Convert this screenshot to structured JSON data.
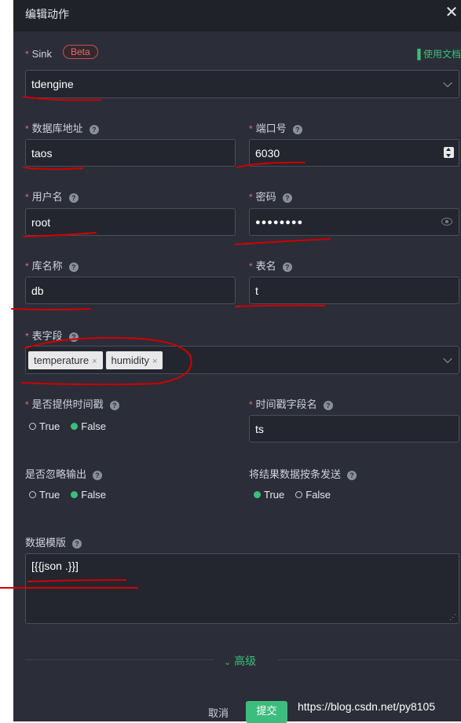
{
  "dialog": {
    "title": "编辑动作",
    "close_glyph": "✕"
  },
  "sink": {
    "label": "Sink",
    "badge": "Beta",
    "doc_link": "使用文档",
    "value": "tdengine"
  },
  "fields": {
    "host": {
      "label": "数据库地址",
      "value": "taos"
    },
    "port": {
      "label": "端口号",
      "value": "6030"
    },
    "user": {
      "label": "用户名",
      "value": "root"
    },
    "password": {
      "label": "密码",
      "value": "●●●●●●●●"
    },
    "database": {
      "label": "库名称",
      "value": "db"
    },
    "table": {
      "label": "表名",
      "value": "t"
    },
    "columns": {
      "label": "表字段",
      "tags": [
        "temperature",
        "humidity"
      ]
    },
    "provide_ts": {
      "label": "是否提供时间戳",
      "options": [
        "True",
        "False"
      ],
      "selected": "False"
    },
    "ts_field": {
      "label": "时间戳字段名",
      "value": "ts"
    },
    "omit_output": {
      "label": "是否忽略输出",
      "options": [
        "True",
        "False"
      ],
      "selected": "False"
    },
    "send_single": {
      "label": "将结果数据按条发送",
      "options": [
        "True",
        "False"
      ],
      "selected": "True"
    },
    "template": {
      "label": "数据模版",
      "value": "[{{json .}}]"
    }
  },
  "advanced_label": "高级",
  "buttons": {
    "cancel": "取消",
    "submit": "提交"
  },
  "watermark": "https://blog.csdn.net/py8105",
  "help_glyph": "?",
  "required_mark": "*",
  "colors": {
    "accent": "#3dbd7d",
    "panel_bg": "#2b2e38",
    "required": "#e06b75",
    "annotation": "#d00000"
  }
}
